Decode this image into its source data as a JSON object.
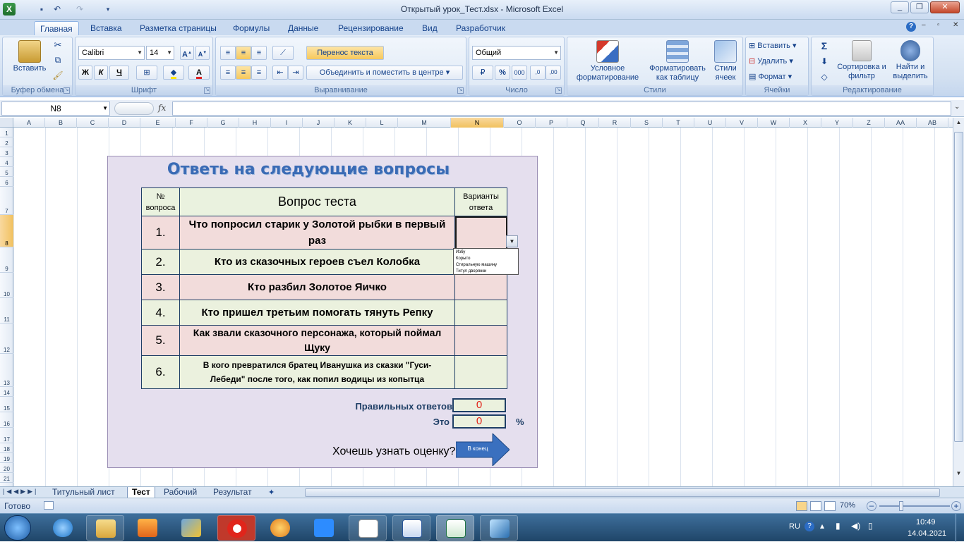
{
  "window": {
    "title": "Открытый урок_Тест.xlsx - Microsoft Excel"
  },
  "tabs": [
    "Главная",
    "Вставка",
    "Разметка страницы",
    "Формулы",
    "Данные",
    "Рецензирование",
    "Вид",
    "Разработчик"
  ],
  "ribbon": {
    "clipboard": {
      "paste": "Вставить",
      "label": "Буфер обмена"
    },
    "font": {
      "name": "Calibri",
      "size": "14",
      "bold": "Ж",
      "italic": "К",
      "underline": "Ч",
      "label": "Шрифт"
    },
    "alignment": {
      "wrap": "Перенос текста",
      "merge": "Объединить и поместить в центре",
      "label": "Выравнивание"
    },
    "number": {
      "format": "Общий",
      "label": "Число"
    },
    "styles": {
      "conditional": "Условное форматирование",
      "table": "Форматировать как таблицу",
      "cell": "Стили ячеек",
      "label": "Стили"
    },
    "cells": {
      "insert": "Вставить",
      "delete": "Удалить",
      "format": "Формат",
      "label": "Ячейки"
    },
    "editing": {
      "sort": "Сортировка и фильтр",
      "find": "Найти и выделить",
      "label": "Редактирование"
    }
  },
  "formula_bar": {
    "name_box": "N8",
    "fx": "fx",
    "formula": ""
  },
  "columns": [
    "A",
    "B",
    "C",
    "D",
    "E",
    "F",
    "G",
    "H",
    "I",
    "J",
    "K",
    "L",
    "M",
    "N",
    "O",
    "P",
    "Q",
    "R",
    "S",
    "T",
    "U",
    "V",
    "W",
    "X",
    "Y",
    "Z",
    "AA",
    "AB"
  ],
  "selected_column": "N",
  "rows": [
    "1",
    "2",
    "3",
    "4",
    "5",
    "6",
    "7",
    "8",
    "9",
    "10",
    "11",
    "12",
    "13",
    "14",
    "15",
    "16",
    "17",
    "18",
    "19",
    "20",
    "21"
  ],
  "selected_row": "8",
  "sheet": {
    "title": "Ответь на следующие вопросы",
    "headers": {
      "num": "№ вопроса",
      "question": "Вопрос теста",
      "answers": "Варианты ответа"
    },
    "questions": [
      {
        "num": "1.",
        "text": "Что попросил старик у Золотой рыбки в первый раз",
        "answer": ""
      },
      {
        "num": "2.",
        "text": "Кто из сказочных героев съел Колобка",
        "answer": ""
      },
      {
        "num": "3.",
        "text": "Кто разбил Золотое Яичко",
        "answer": ""
      },
      {
        "num": "4.",
        "text": "Кто пришел третьим помогать тянуть Репку",
        "answer": ""
      },
      {
        "num": "5.",
        "text": "Как звали сказочного персонажа, который поймал Щуку",
        "answer": ""
      },
      {
        "num": "6.",
        "text": "В кого превратился братец Иванушка из сказки \"Гуси-Лебеди\" после того, как попил водицы из копытца",
        "answer": ""
      }
    ],
    "dropdown_options": [
      "Избу",
      "Корыто",
      "Стиральную машину",
      "Титул дворянки"
    ],
    "correct_label": "Правильных ответов",
    "correct_value": "0",
    "percent_label": "Это",
    "percent_value": "0",
    "percent_sign": "%",
    "grade_prompt": "Хочешь узнать оценку?",
    "end_button": "В конец"
  },
  "sheet_tabs": [
    "Титульный лист",
    "Тест",
    "Рабочий",
    "Результат"
  ],
  "active_sheet": "Тест",
  "status": {
    "ready": "Готово",
    "zoom": "70%"
  },
  "taskbar": {
    "lang": "RU",
    "time": "10:49",
    "date": "14.04.2021"
  }
}
